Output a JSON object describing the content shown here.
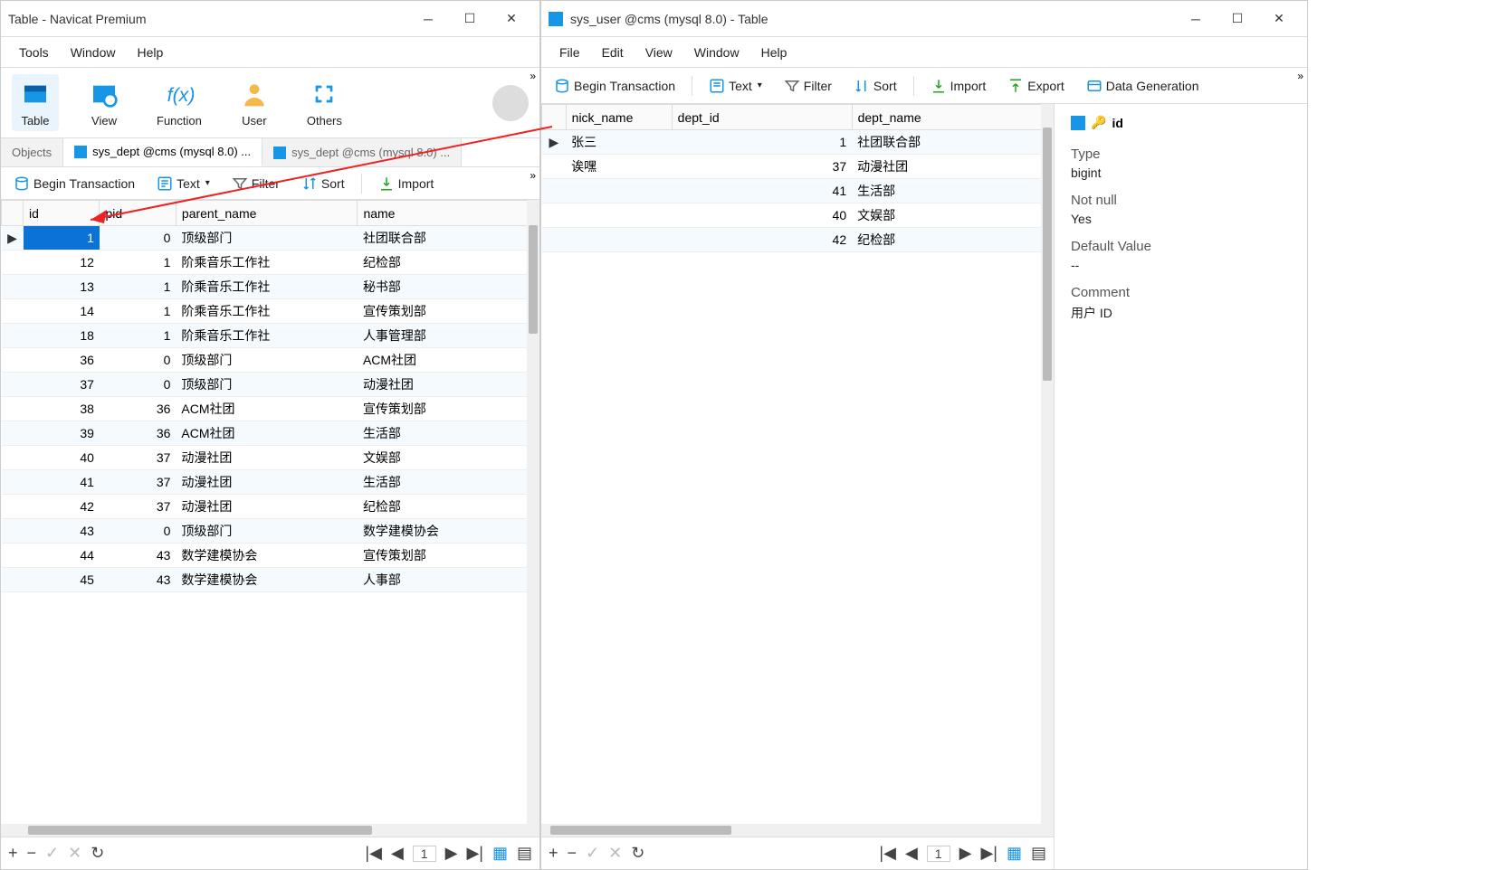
{
  "left_window": {
    "title": "Table - Navicat Premium",
    "menu": [
      "Tools",
      "Window",
      "Help"
    ],
    "ribbon": [
      {
        "key": "table",
        "label": "Table",
        "active": true
      },
      {
        "key": "view",
        "label": "View"
      },
      {
        "key": "function",
        "label": "Function"
      },
      {
        "key": "user",
        "label": "User"
      },
      {
        "key": "others",
        "label": "Others"
      }
    ],
    "tabs": [
      {
        "label": "Objects",
        "active": false,
        "plain": true
      },
      {
        "label": "sys_dept @cms (mysql 8.0) ...",
        "active": true
      },
      {
        "label": "sys_dept @cms (mysql 8.0) ...",
        "active": false
      }
    ],
    "toolbar": {
      "begin_tx": "Begin Transaction",
      "text": "Text",
      "filter": "Filter",
      "sort": "Sort",
      "import": "Import"
    },
    "columns": [
      "id",
      "pid",
      "parent_name",
      "name"
    ],
    "rows": [
      {
        "id": 1,
        "pid": 0,
        "parent_name": "顶级部门",
        "name": "社团联合部",
        "selected": true
      },
      {
        "id": 12,
        "pid": 1,
        "parent_name": "阶乘音乐工作社",
        "name": "纪检部"
      },
      {
        "id": 13,
        "pid": 1,
        "parent_name": "阶乘音乐工作社",
        "name": "秘书部"
      },
      {
        "id": 14,
        "pid": 1,
        "parent_name": "阶乘音乐工作社",
        "name": "宣传策划部"
      },
      {
        "id": 18,
        "pid": 1,
        "parent_name": "阶乘音乐工作社",
        "name": "人事管理部"
      },
      {
        "id": 36,
        "pid": 0,
        "parent_name": "顶级部门",
        "name": "ACM社团"
      },
      {
        "id": 37,
        "pid": 0,
        "parent_name": "顶级部门",
        "name": "动漫社团"
      },
      {
        "id": 38,
        "pid": 36,
        "parent_name": "ACM社团",
        "name": "宣传策划部"
      },
      {
        "id": 39,
        "pid": 36,
        "parent_name": "ACM社团",
        "name": "生活部"
      },
      {
        "id": 40,
        "pid": 37,
        "parent_name": "动漫社团",
        "name": "文娱部"
      },
      {
        "id": 41,
        "pid": 37,
        "parent_name": "动漫社团",
        "name": "生活部"
      },
      {
        "id": 42,
        "pid": 37,
        "parent_name": "动漫社团",
        "name": "纪检部"
      },
      {
        "id": 43,
        "pid": 0,
        "parent_name": "顶级部门",
        "name": "数学建模协会"
      },
      {
        "id": 44,
        "pid": 43,
        "parent_name": "数学建模协会",
        "name": "宣传策划部"
      },
      {
        "id": 45,
        "pid": 43,
        "parent_name": "数学建模协会",
        "name": "人事部"
      }
    ],
    "status_page": "1"
  },
  "right_window": {
    "title": "sys_user @cms (mysql 8.0) - Table",
    "menu": [
      "File",
      "Edit",
      "View",
      "Window",
      "Help"
    ],
    "toolbar": {
      "begin_tx": "Begin Transaction",
      "text": "Text",
      "filter": "Filter",
      "sort": "Sort",
      "import": "Import",
      "export": "Export",
      "data_gen": "Data Generation"
    },
    "columns": [
      "nick_name",
      "dept_id",
      "dept_name"
    ],
    "rows": [
      {
        "nick_name": "张三",
        "dept_id": 1,
        "dept_name": "社团联合部",
        "selected": true
      },
      {
        "nick_name": "诶嘿",
        "dept_id": 37,
        "dept_name": "动漫社团"
      },
      {
        "nick_name": "",
        "dept_id": 41,
        "dept_name": "生活部"
      },
      {
        "nick_name": "",
        "dept_id": 40,
        "dept_name": "文娱部"
      },
      {
        "nick_name": "",
        "dept_id": 42,
        "dept_name": "纪检部"
      }
    ],
    "status_page": "1",
    "props": {
      "field": "id",
      "type_label": "Type",
      "type_val": "bigint",
      "notnull_label": "Not null",
      "notnull_val": "Yes",
      "default_label": "Default Value",
      "default_val": "--",
      "comment_label": "Comment",
      "comment_val": "用户 ID"
    }
  }
}
